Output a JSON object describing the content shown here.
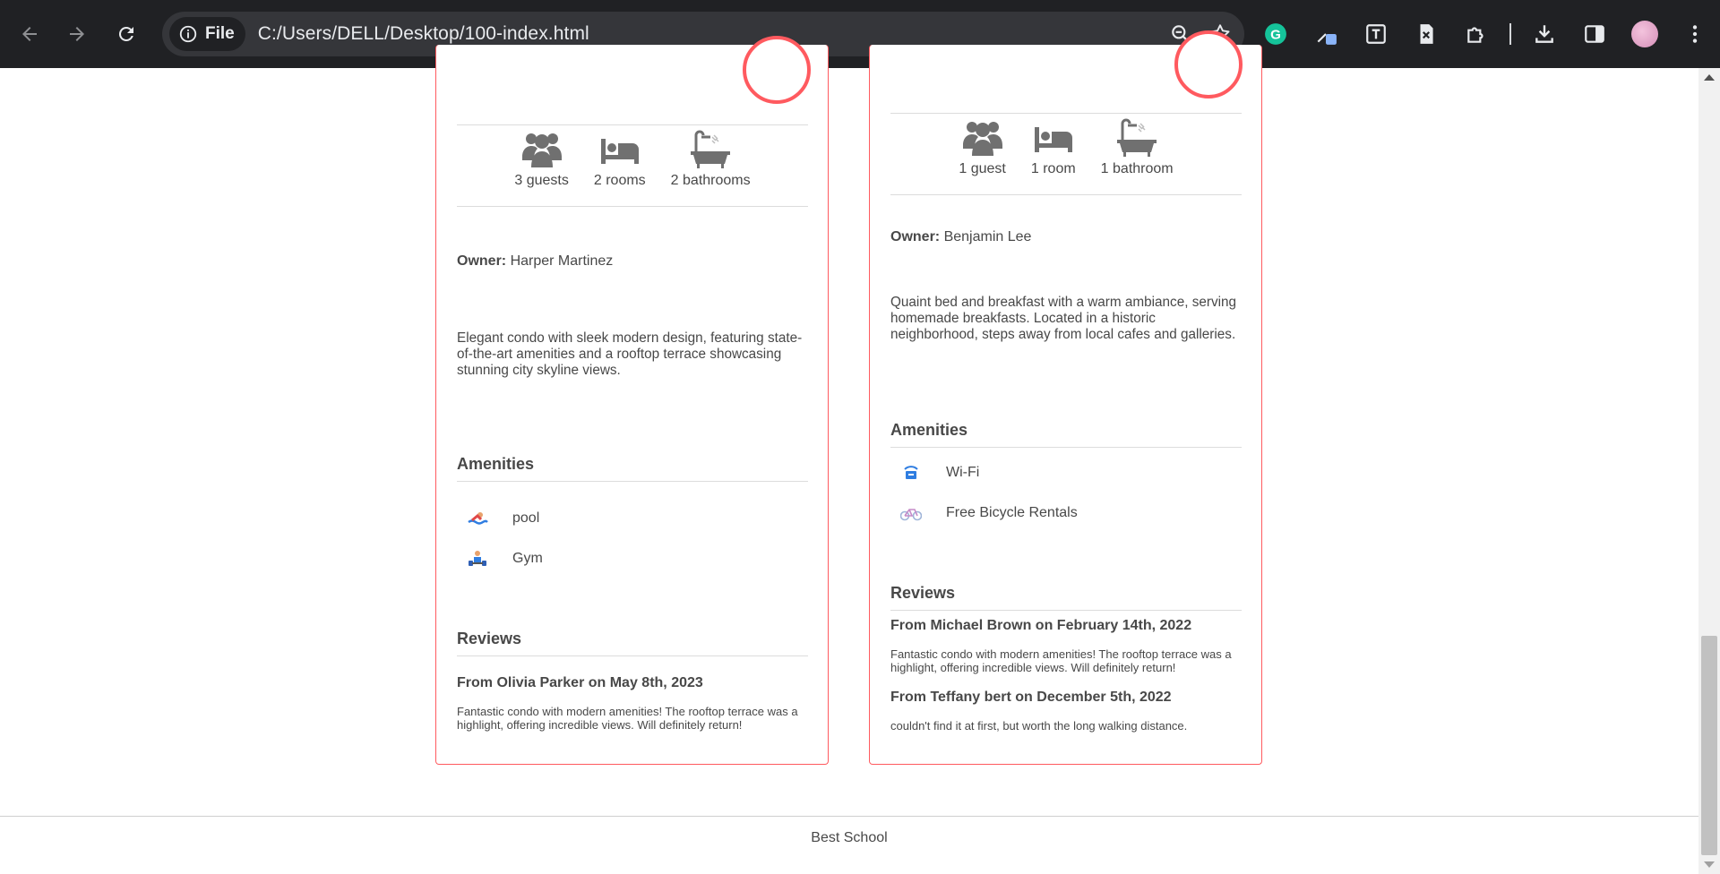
{
  "browser": {
    "site_chip_label": "File",
    "url": "C:/Users/DELL/Desktop/100-index.html"
  },
  "places": [
    {
      "info": {
        "guests": "3 guests",
        "rooms": "2 rooms",
        "bathrooms": "2 bathrooms"
      },
      "owner_label": "Owner:",
      "owner_name": "Harper Martinez",
      "description": "Elegant condo with sleek modern design, featuring state-of-the-art amenities and a rooftop terrace showcasing stunning city skyline views.",
      "amenities_title": "Amenities",
      "amenities": [
        {
          "name": "pool",
          "icon": "pool-icon"
        },
        {
          "name": "Gym",
          "icon": "gym-icon"
        }
      ],
      "reviews_title": "Reviews",
      "reviews": [
        {
          "header": "From Olivia Parker on May 8th, 2023",
          "text": "Fantastic condo with modern amenities! The rooftop terrace was a highlight, offering incredible views. Will definitely return!"
        }
      ]
    },
    {
      "info": {
        "guests": "1 guest",
        "rooms": "1 room",
        "bathrooms": "1 bathroom"
      },
      "owner_label": "Owner:",
      "owner_name": "Benjamin Lee",
      "description": "Quaint bed and breakfast with a warm ambiance, serving homemade breakfasts. Located in a historic neighborhood, steps away from local cafes and galleries.",
      "amenities_title": "Amenities",
      "amenities": [
        {
          "name": "Wi-Fi",
          "icon": "wifi-icon"
        },
        {
          "name": "Free Bicycle Rentals",
          "icon": "bicycle-icon"
        }
      ],
      "reviews_title": "Reviews",
      "reviews": [
        {
          "header": "From Michael Brown on February 14th, 2022",
          "text": "Fantastic condo with modern amenities! The rooftop terrace was a highlight, offering incredible views. Will definitely return!"
        },
        {
          "header": "From Teffany bert on December 5th, 2022",
          "text": "couldn't find it at first, but worth the long walking distance."
        }
      ]
    }
  ],
  "footer": {
    "text": "Best School"
  },
  "colors": {
    "accent": "#ff5a5f",
    "text": "#484848",
    "chrome_bg": "#202124",
    "omnibox_bg": "#35363a"
  }
}
